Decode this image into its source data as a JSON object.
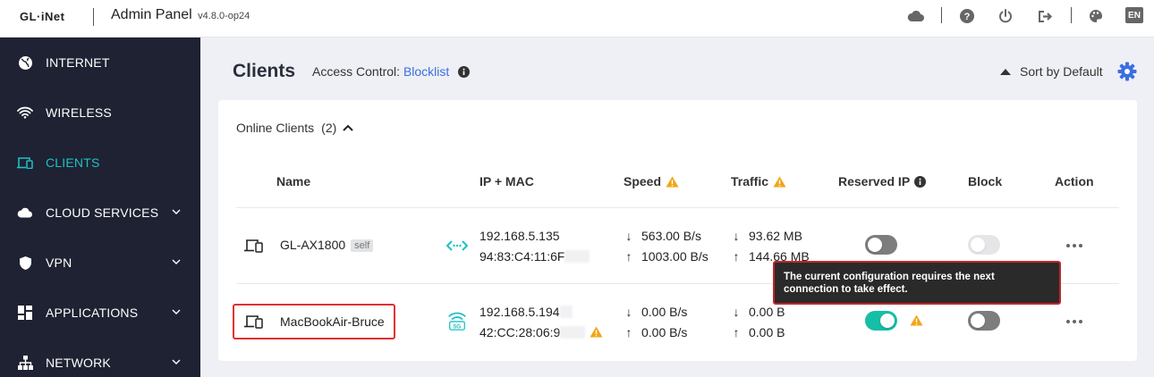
{
  "header": {
    "logo": "GL·iNet",
    "title": "Admin Panel",
    "version": "v4.8.0-op24",
    "lang": "EN"
  },
  "sidebar": {
    "items": [
      {
        "label": "INTERNET",
        "icon": "globe-icon"
      },
      {
        "label": "WIRELESS",
        "icon": "wifi-icon"
      },
      {
        "label": "CLIENTS",
        "icon": "devices-icon",
        "active": true
      },
      {
        "label": "CLOUD SERVICES",
        "icon": "cloud-icon",
        "expandable": true
      },
      {
        "label": "VPN",
        "icon": "shield-icon",
        "expandable": true
      },
      {
        "label": "APPLICATIONS",
        "icon": "grid-icon",
        "expandable": true
      },
      {
        "label": "NETWORK",
        "icon": "network-icon",
        "expandable": true
      }
    ]
  },
  "page": {
    "title": "Clients",
    "access_control_label": "Access Control:",
    "access_control_value": "Blocklist",
    "sort_label": "Sort by Default"
  },
  "online": {
    "label": "Online Clients",
    "count": "(2)"
  },
  "columns": {
    "name": "Name",
    "ip_mac": "IP + MAC",
    "speed": "Speed",
    "traffic": "Traffic",
    "reserved_ip": "Reserved IP",
    "block": "Block",
    "action": "Action"
  },
  "clients": [
    {
      "name": "GL-AX1800",
      "badge": "self",
      "ip": "192.168.5.135",
      "mac": "94:83:C4:11:6F",
      "speed_down": "563.00 B/s",
      "speed_up": "1003.00 B/s",
      "traffic_down": "93.62 MB",
      "traffic_up": "144.66 MB",
      "connection": "ethernet-icon",
      "reserved_ip": false,
      "block": false
    },
    {
      "name": "MacBookAir-Bruce",
      "ip": "192.168.5.194",
      "mac": "42:CC:28:06:9",
      "speed_down": "0.00 B/s",
      "speed_up": "0.00 B/s",
      "traffic_down": "0.00 B",
      "traffic_up": "0.00 B",
      "connection": "wifi-5g-icon",
      "band": "5G",
      "reserved_ip": true,
      "block": false
    }
  ],
  "tooltip": {
    "text": "The current configuration requires the next connection to take effect."
  },
  "colors": {
    "accent": "#15bfa6",
    "active_nav": "#1ec1c6",
    "link": "#3b6fe0",
    "warning": "#f2a516",
    "sidebar_bg": "#1e2232",
    "highlight": "#e03030"
  }
}
